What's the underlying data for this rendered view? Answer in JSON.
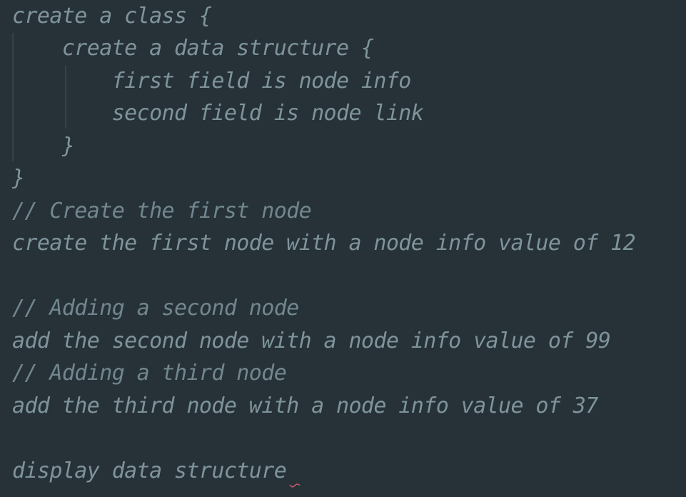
{
  "editor": {
    "lines": [
      "create a class {",
      "    create a data structure {",
      "        first field is node info",
      "        second field is node link",
      "    }",
      "}",
      "// Create the first node",
      "create the first node with a node info value of 12",
      "",
      "// Adding a second node",
      "add the second node with a node info value of 99",
      "// Adding a third node",
      "add the third node with a node info value of 37",
      "",
      "display data structure"
    ]
  },
  "colors": {
    "background": "#263238",
    "text": "#7f939b",
    "indent_guide": "#34434a",
    "spell_squiggle": "#c2586a"
  }
}
